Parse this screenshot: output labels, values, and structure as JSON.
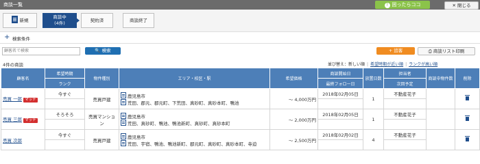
{
  "header": {
    "title": "商談一覧",
    "help_label": "困ったらココ",
    "close_label": "閉じる"
  },
  "steps": [
    {
      "label": "新規"
    },
    {
      "label": "商談中",
      "sub": "(4件)"
    },
    {
      "label": "契約済"
    },
    {
      "label": "商談終了"
    }
  ],
  "search": {
    "section_label": "検索条件",
    "placeholder": "顧客名で検索",
    "button_label": "検索",
    "add_label": "追客",
    "print_label": "商談リスト印刷"
  },
  "result_count": "4件の商談",
  "sort": {
    "label": "並び替え：",
    "options": [
      "新しい順",
      "希望時期が近い順",
      "ランクが高い順"
    ]
  },
  "table": {
    "headers": {
      "customer": "顧客名",
      "timing": "希望時期",
      "rank": "ランク",
      "type": "物件種別",
      "area": "エリア・校区・駅",
      "price": "希望価格",
      "start_date": "商談開始日",
      "follow_date": "最終フォロー日",
      "pages": "放置日数",
      "staff": "担当者",
      "next": "次回予定",
      "props": "商談中物件数",
      "delete": "削除"
    },
    "rows": [
      {
        "name": "売買 一郎",
        "badge": "マッチ",
        "timing": "今すぐ",
        "rank": "",
        "type": "売買戸建",
        "area1": "鹿児島市",
        "area2": "荒田、郡元、郡元町、下荒田、真砂町、真砂本町、鴨池",
        "price": "～ 4,000万円",
        "start_date": "2018年02月05日",
        "follow_date": "",
        "days": "1",
        "staff": "不動産花子",
        "next": "",
        "props": ""
      },
      {
        "name": "売買 三郎",
        "badge": "マッチ",
        "timing": "そろそろ",
        "rank": "",
        "type": "売買マンション",
        "area1": "鹿児島市",
        "area2": "荒田、真砂町、鴨池、鴨池新町、真砂町、真砂本町",
        "price": "～ 2,000万円",
        "start_date": "2018年02月05日",
        "follow_date": "",
        "days": "1",
        "staff": "不動産花子",
        "next": "",
        "props": ""
      },
      {
        "name": "売買 次郎",
        "badge": "",
        "timing": "今すぐ",
        "rank": "",
        "type": "売買戸建",
        "area1": "鹿児島市",
        "area2": "荒田、宇宿、鴨池、鴨池新町、郡元町、真砂町、真砂本町、寺迫",
        "price": "～ 2,500万円",
        "start_date": "2018年02月02日",
        "follow_date": "",
        "days": "4",
        "staff": "不動産花子",
        "next": "",
        "props": ""
      }
    ]
  }
}
